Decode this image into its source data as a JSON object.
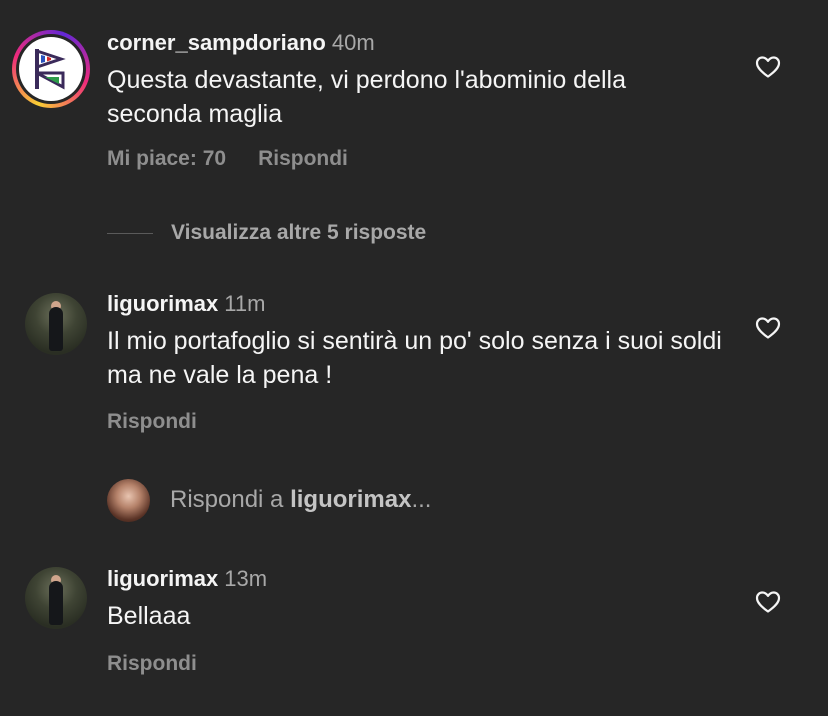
{
  "comments": [
    {
      "username": "corner_sampdoriano",
      "time": "40m",
      "text": "Questa devastante, vi perdono l'abominio della seconda maglia",
      "likes": "Mi piace: 70",
      "reply": "Rispondi",
      "avatar": "story-ring-logo"
    },
    {
      "username": "liguorimax",
      "time": "11m",
      "text": "Il mio portafoglio si sentirà un po' solo senza i suoi soldi ma ne vale la pena !",
      "reply": "Rispondi",
      "avatar": "photo"
    },
    {
      "username": "liguorimax",
      "time": "13m",
      "text": "Bellaaa",
      "reply": "Rispondi",
      "avatar": "photo"
    }
  ],
  "view_more": "Visualizza altre 5 risposte",
  "reply_prompt": {
    "prefix": "Rispondi a ",
    "username": "liguorimax",
    "suffix": "..."
  },
  "icons": {
    "like": "heart-outline-icon"
  },
  "colors": {
    "background": "#262626",
    "text_primary": "#f5f5f5",
    "text_secondary": "#a8a8a8"
  }
}
